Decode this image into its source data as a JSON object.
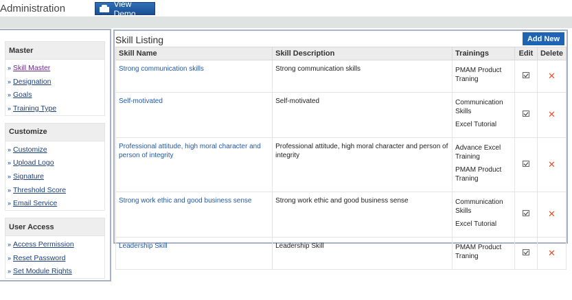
{
  "header": {
    "title": "Administration",
    "view_demo_label": "View Demo"
  },
  "sidebar": {
    "sections": [
      {
        "title": "Master",
        "items": [
          "Skill Master",
          "Designation",
          "Goals",
          "Training Type"
        ]
      },
      {
        "title": "Customize",
        "items": [
          "Customize",
          "Upload Logo",
          "Signature",
          "Threshold Score",
          "Email Service"
        ]
      },
      {
        "title": "User Access",
        "items": [
          "Access Permission",
          "Reset Password",
          "Set Module Rights"
        ]
      }
    ]
  },
  "main": {
    "title": "Skill Listing",
    "add_new_label": "Add New",
    "columns": [
      "Skill Name",
      "Skill Description",
      "Trainings",
      "Edit",
      "Delete"
    ],
    "rows": [
      {
        "name": "Strong communication skills",
        "description": "Strong communication skills",
        "trainings": [
          "PMAM Product Traning"
        ]
      },
      {
        "name": "Self-motivated",
        "description": "Self-motivated",
        "trainings": [
          "Communication Skills",
          "Excel Tutorial"
        ]
      },
      {
        "name": "Professional attitude, high moral character and person of integrity",
        "description": "Professional attitude, high moral character and person of integrity",
        "trainings": [
          "Advance Excel Training",
          "PMAM Product Traning"
        ]
      },
      {
        "name": "Strong work ethic and good business sense",
        "description": "Strong work ethic and good business sense",
        "trainings": [
          "Communication Skills",
          "Excel Tutorial"
        ]
      },
      {
        "name": "Leadership Skill",
        "description": "Leadership Skill",
        "trainings": [
          "PMAM Product Traning"
        ]
      }
    ]
  },
  "icons": {
    "edit": "edit-checkbox-icon",
    "delete": "delete-x-icon",
    "delete_color": "#e2502c",
    "accent": "#1f63b5"
  }
}
